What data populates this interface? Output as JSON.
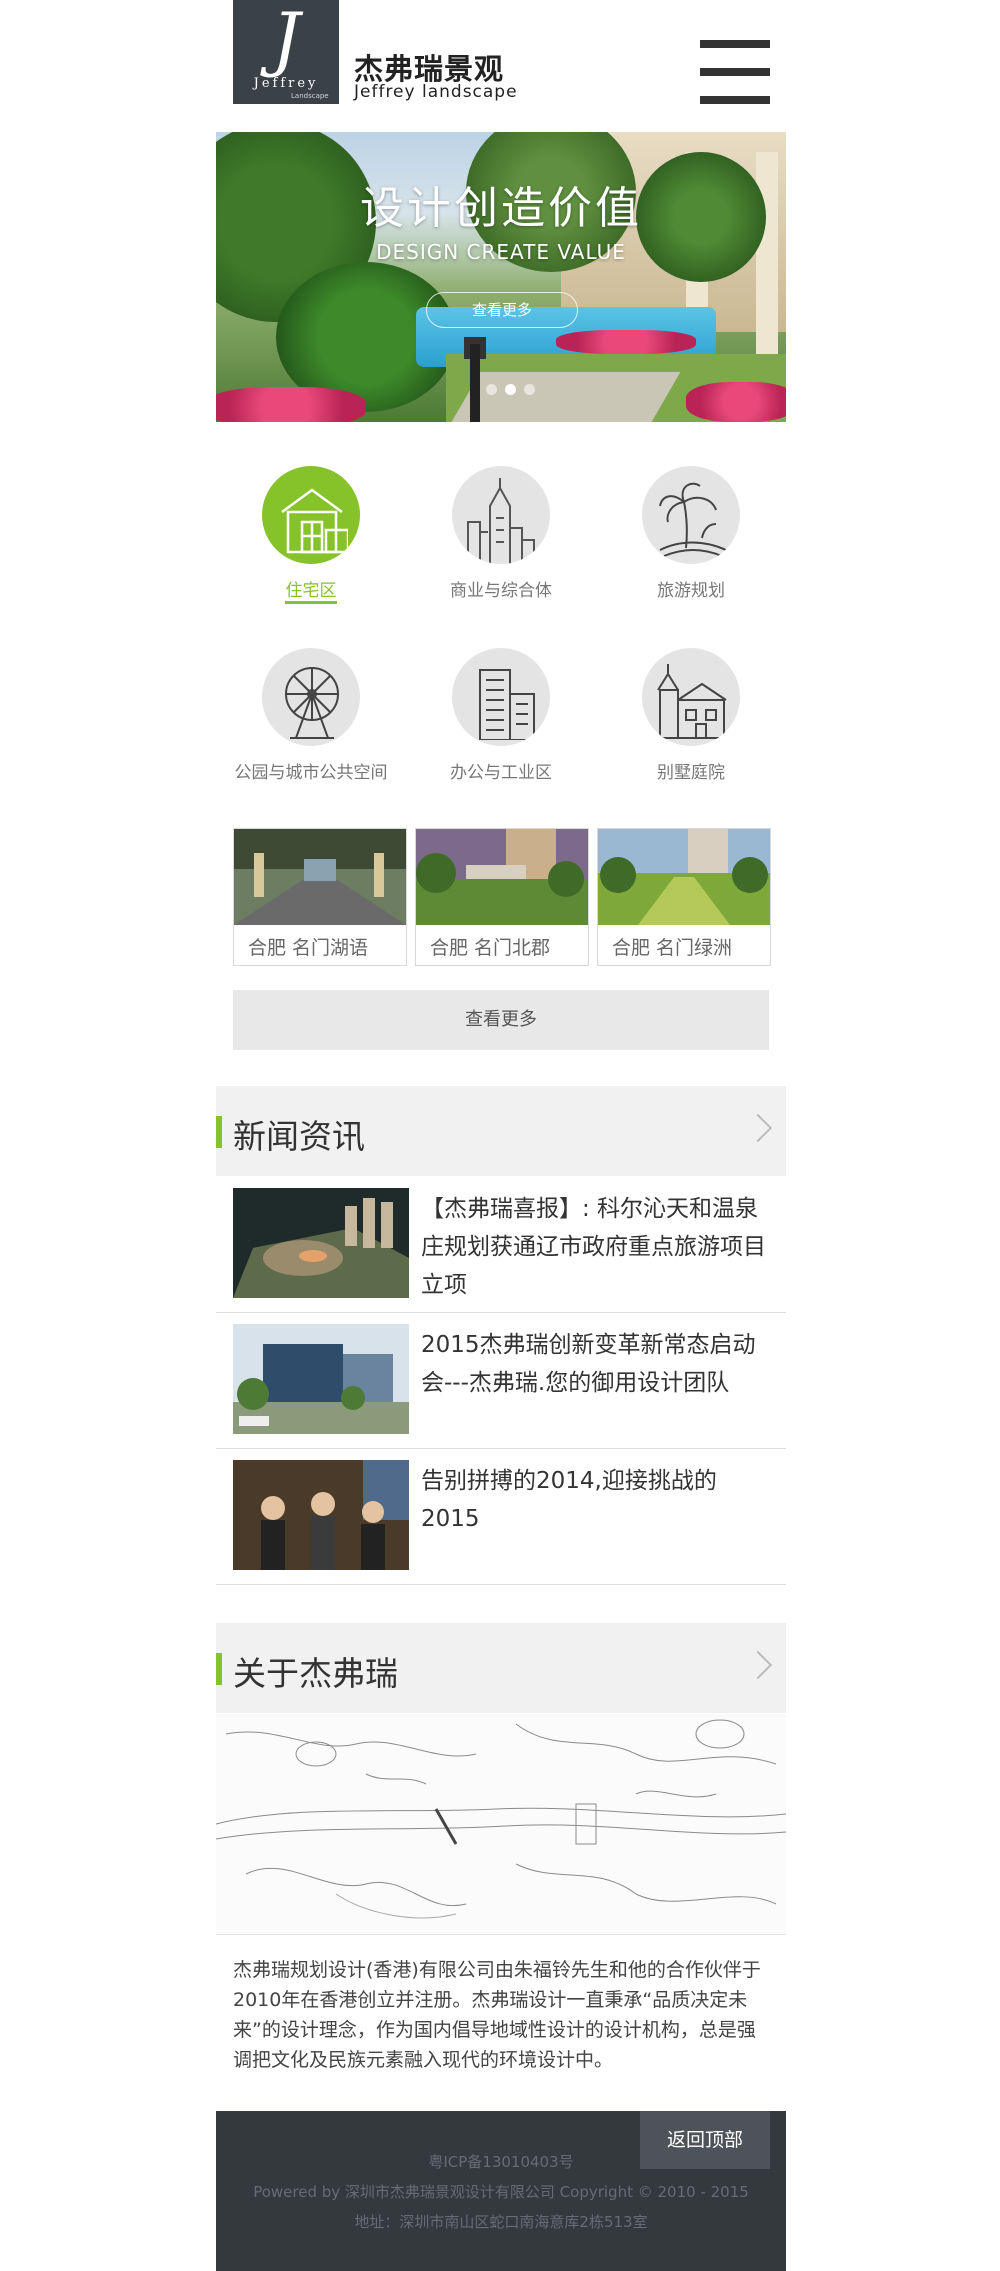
{
  "header": {
    "logo_letter": "J",
    "logo_word": "Jeffrey",
    "logo_sub": "Landscape",
    "brand_cn": "杰弗瑞景观",
    "brand_en": "Jeffrey landscape"
  },
  "banner": {
    "title": "设计创造价值",
    "subtitle": "DESIGN CREATE VALUE",
    "more_label": "查看更多",
    "slide_count": 3,
    "active_slide": 2
  },
  "categories": [
    {
      "label": "住宅区",
      "icon": "house-icon",
      "active": true
    },
    {
      "label": "商业与综合体",
      "icon": "skyscraper-icon",
      "active": false
    },
    {
      "label": "旅游规划",
      "icon": "palm-tree-icon",
      "active": false
    },
    {
      "label": "公园与城市公共空间",
      "icon": "ferris-wheel-icon",
      "active": false
    },
    {
      "label": "办公与工业区",
      "icon": "office-building-icon",
      "active": false
    },
    {
      "label": "别墅庭院",
      "icon": "villa-icon",
      "active": false
    }
  ],
  "projects": [
    {
      "title": "合肥 名门湖语"
    },
    {
      "title": "合肥 名门北郡"
    },
    {
      "title": "合肥 名门绿洲"
    }
  ],
  "projects_more": "查看更多",
  "news": {
    "title": "新闻资讯",
    "items": [
      {
        "text": "【杰弗瑞喜报】: 科尔沁天和温泉庄规划获通辽市政府重点旅游项目立项"
      },
      {
        "text": "2015杰弗瑞创新变革新常态启动会---杰弗瑞.您的御用设计团队"
      },
      {
        "text": "告别拼搏的2014,迎接挑战的2015"
      }
    ]
  },
  "about": {
    "title": "关于杰弗瑞",
    "text": "杰弗瑞规划设计(香港)有限公司由朱福铃先生和他的合作伙伴于2010年在香港创立并注册。杰弗瑞设计一直秉承“品质决定未来”的设计理念，作为国内倡导地域性设计的设计机构，总是强调把文化及民族元素融入现代的环境设计中。"
  },
  "footer": {
    "back_top": "返回顶部",
    "icp": "粤ICP备13010403号",
    "powered": "Powered by 深圳市杰弗瑞景观设计有限公司 Copyright © 2010 - 2015",
    "address": "地址：深圳市南山区蛇口南海意库2栋513室"
  },
  "colors": {
    "accent": "#86c22a",
    "dark": "#34393e",
    "logo_bg": "#3a4147"
  }
}
